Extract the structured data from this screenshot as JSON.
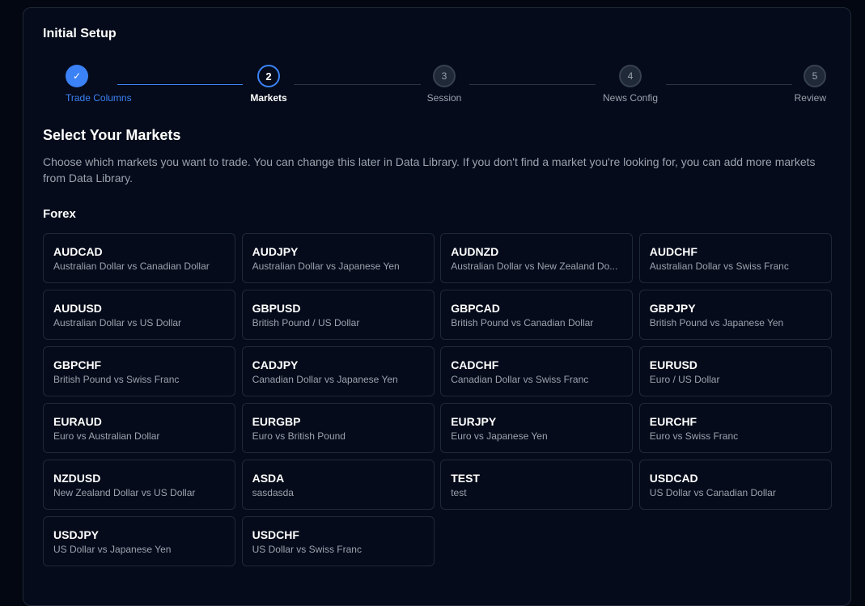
{
  "setup": {
    "title": "Initial Setup"
  },
  "stepper": {
    "steps": [
      {
        "number": "✓",
        "label": "Trade Columns",
        "state": "done"
      },
      {
        "number": "2",
        "label": "Markets",
        "state": "active"
      },
      {
        "number": "3",
        "label": "Session",
        "state": "pending"
      },
      {
        "number": "4",
        "label": "News Config",
        "state": "pending"
      },
      {
        "number": "5",
        "label": "Review",
        "state": "pending"
      }
    ]
  },
  "content": {
    "heading": "Select Your Markets",
    "description": "Choose which markets you want to trade. You can change this later in Data Library. If you don't find a market you're looking for, you can add more markets from Data Library.",
    "group_title": "Forex"
  },
  "markets": [
    {
      "code": "AUDCAD",
      "name": "Australian Dollar vs Canadian Dollar"
    },
    {
      "code": "AUDJPY",
      "name": "Australian Dollar vs Japanese Yen"
    },
    {
      "code": "AUDNZD",
      "name": "Australian Dollar vs New Zealand Do..."
    },
    {
      "code": "AUDCHF",
      "name": "Australian Dollar vs Swiss Franc"
    },
    {
      "code": "AUDUSD",
      "name": "Australian Dollar vs US Dollar"
    },
    {
      "code": "GBPUSD",
      "name": "British Pound / US Dollar"
    },
    {
      "code": "GBPCAD",
      "name": "British Pound vs Canadian Dollar"
    },
    {
      "code": "GBPJPY",
      "name": "British Pound vs Japanese Yen"
    },
    {
      "code": "GBPCHF",
      "name": "British Pound vs Swiss Franc"
    },
    {
      "code": "CADJPY",
      "name": "Canadian Dollar vs Japanese Yen"
    },
    {
      "code": "CADCHF",
      "name": "Canadian Dollar vs Swiss Franc"
    },
    {
      "code": "EURUSD",
      "name": "Euro / US Dollar"
    },
    {
      "code": "EURAUD",
      "name": "Euro vs Australian Dollar"
    },
    {
      "code": "EURGBP",
      "name": "Euro vs British Pound"
    },
    {
      "code": "EURJPY",
      "name": "Euro vs Japanese Yen"
    },
    {
      "code": "EURCHF",
      "name": "Euro vs Swiss Franc"
    },
    {
      "code": "NZDUSD",
      "name": "New Zealand Dollar vs US Dollar"
    },
    {
      "code": "ASDA",
      "name": "sasdasda"
    },
    {
      "code": "TEST",
      "name": "test"
    },
    {
      "code": "USDCAD",
      "name": "US Dollar vs Canadian Dollar"
    },
    {
      "code": "USDJPY",
      "name": "US Dollar vs Japanese Yen"
    },
    {
      "code": "USDCHF",
      "name": "US Dollar vs Swiss Franc"
    }
  ],
  "colors": {
    "accent": "#3b82f6",
    "background": "#030712",
    "panel": "#050b1a",
    "border": "#1f2937"
  }
}
